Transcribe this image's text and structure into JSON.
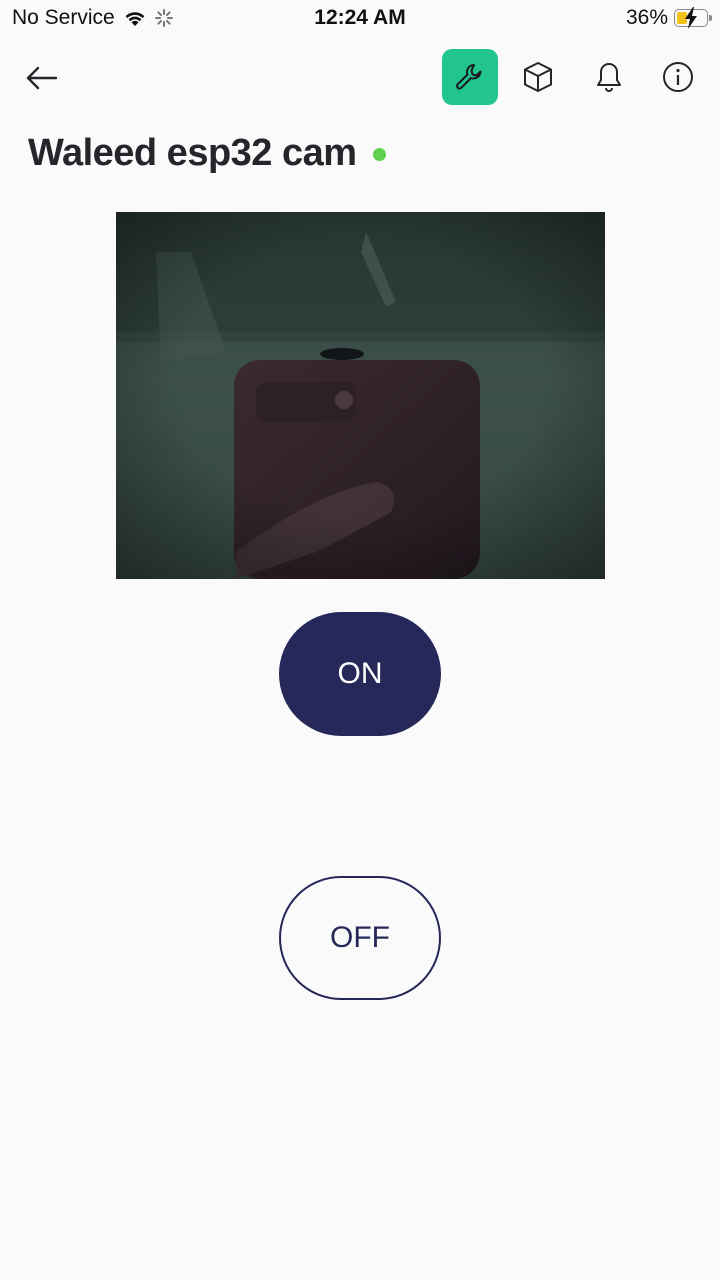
{
  "status_bar": {
    "carrier": "No Service",
    "time": "12:24 AM",
    "battery_percent": "36%",
    "battery_level": 0.36,
    "icons": [
      "wifi-icon",
      "loading-spinner-icon",
      "battery-charging-icon"
    ]
  },
  "toolbar": {
    "icons": [
      "back-arrow-icon",
      "wrench-icon",
      "cube-icon",
      "bell-icon",
      "info-icon"
    ],
    "accent_color": "#22c58f"
  },
  "device": {
    "name": "Waleed esp32 cam",
    "online_color": "#5fcf4f"
  },
  "controls": {
    "on_label": "ON",
    "off_label": "OFF",
    "button_color": "#26285a"
  }
}
